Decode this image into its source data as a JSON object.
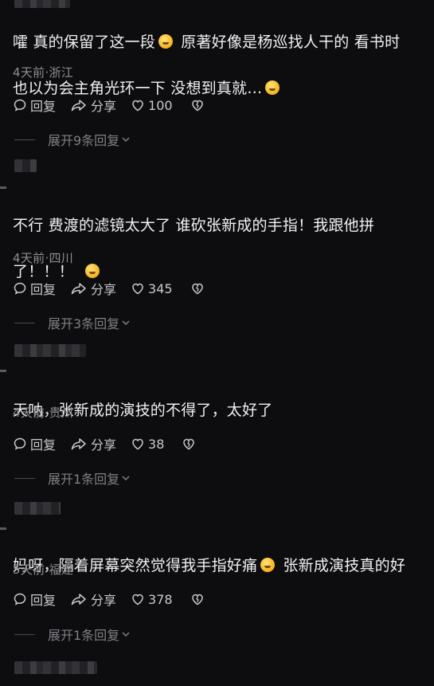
{
  "comments": [
    {
      "text_line1": "嚯 真的保留了这一段",
      "text_line1b": " 原著好像是杨巡找人干的 看书时",
      "text_line2": "也以为会主角光环一下 没想到真就…",
      "meta": "4天前·浙江",
      "reply_label": "回复",
      "share_label": "分享",
      "likes": "100",
      "expand_label": "展开9条回复"
    },
    {
      "text_line1": "不行 费渡的滤镜太大了 谁砍张新成的手指！我跟他拼",
      "text_line2": "了！！！",
      "meta": "4天前·四川",
      "reply_label": "回复",
      "share_label": "分享",
      "likes": "345",
      "expand_label": "展开3条回复"
    },
    {
      "text_line1": "天呐，张新成的演技的不得了，太好了",
      "meta": "4天前·贵州",
      "reply_label": "回复",
      "share_label": "分享",
      "likes": "38",
      "expand_label": "展开1条回复"
    },
    {
      "text_line1": "妈呀，隔着屏幕突然觉得我手指好痛",
      "text_line1b": " 张新成演技真的好",
      "meta": "5天前·福建",
      "reply_label": "回复",
      "share_label": "分享",
      "likes": "378",
      "expand_label": "展开1条回复"
    }
  ],
  "icons": {
    "reply": "comment-bubble-icon",
    "share": "share-arrow-icon",
    "like": "heart-icon",
    "dislike": "broken-heart-icon",
    "expand": "chevron-down-icon"
  },
  "colors": {
    "background": "#0d0d10",
    "text": "#f0f0f0",
    "meta": "#8c8c92",
    "emoji": "#f3b21c"
  }
}
